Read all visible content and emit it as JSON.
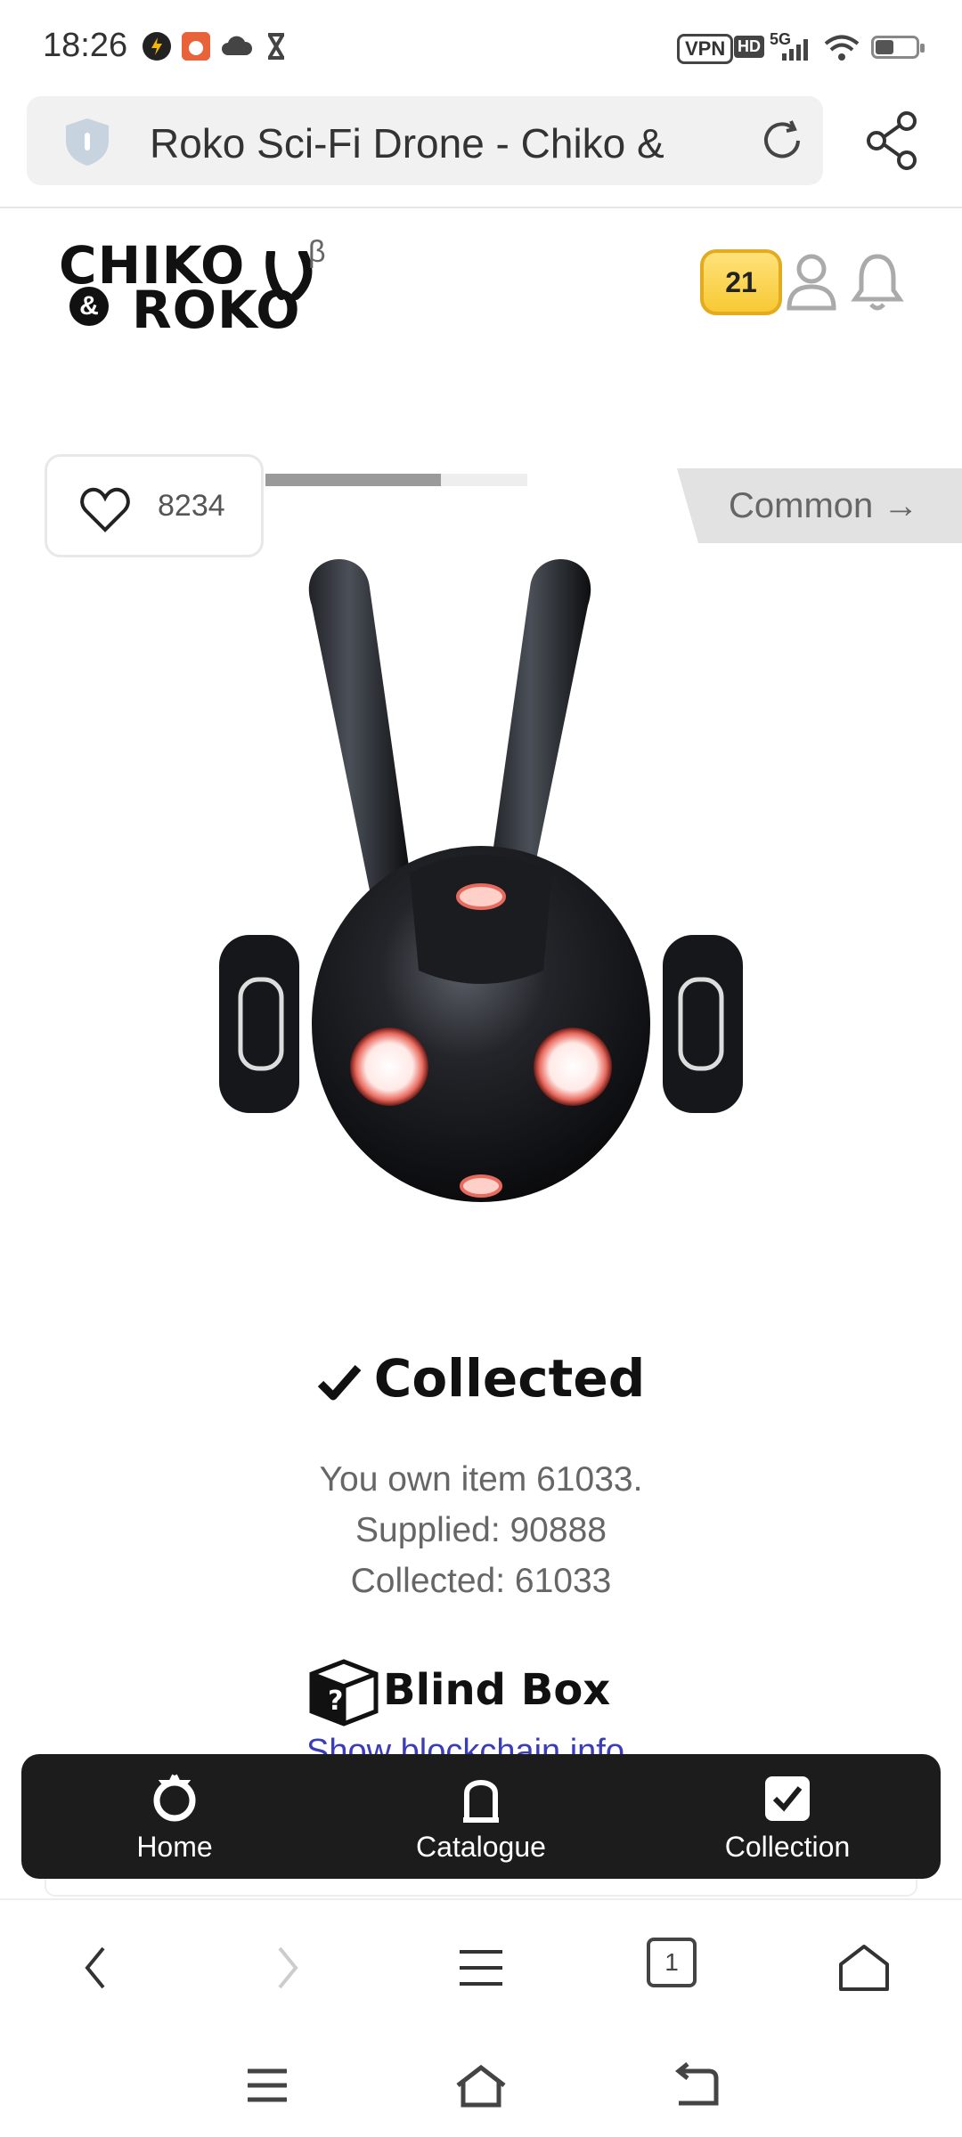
{
  "status_bar": {
    "time": "18:26",
    "vpn": "VPN",
    "hd": "HD",
    "network": "5G",
    "icons": [
      "power-app-icon",
      "alert-app-icon",
      "cloud-icon",
      "hourglass-icon",
      "wifi-icon",
      "battery-icon"
    ]
  },
  "browser": {
    "page_title": "Roko Sci-Fi Drone - Chiko &",
    "tab_count": "1"
  },
  "header": {
    "logo_line1": "CHIKO",
    "logo_amp": "&",
    "logo_line2": "ROKO",
    "beta": "β",
    "coin_count": "21"
  },
  "item": {
    "likes": "8234",
    "collected_progress": 0.67,
    "rarity": "Common →",
    "status": "Collected",
    "owned_text": "You own item 61033.",
    "supplied_text": "Supplied: 90888",
    "collected_text": "Collected: 61033",
    "box_label": "Blind Box",
    "chain_link": "Show blockchain info"
  },
  "app_nav": {
    "items": [
      {
        "label": "Home",
        "icon": "home-gear-icon"
      },
      {
        "label": "Catalogue",
        "icon": "catalogue-icon"
      },
      {
        "label": "Collection",
        "icon": "collection-check-icon"
      }
    ]
  },
  "colors": {
    "accent_gold": "#f7c934",
    "nav_bg": "#1c1c1c",
    "link_blue": "#3b3db8",
    "rarity_bg": "#e2e2e2"
  }
}
